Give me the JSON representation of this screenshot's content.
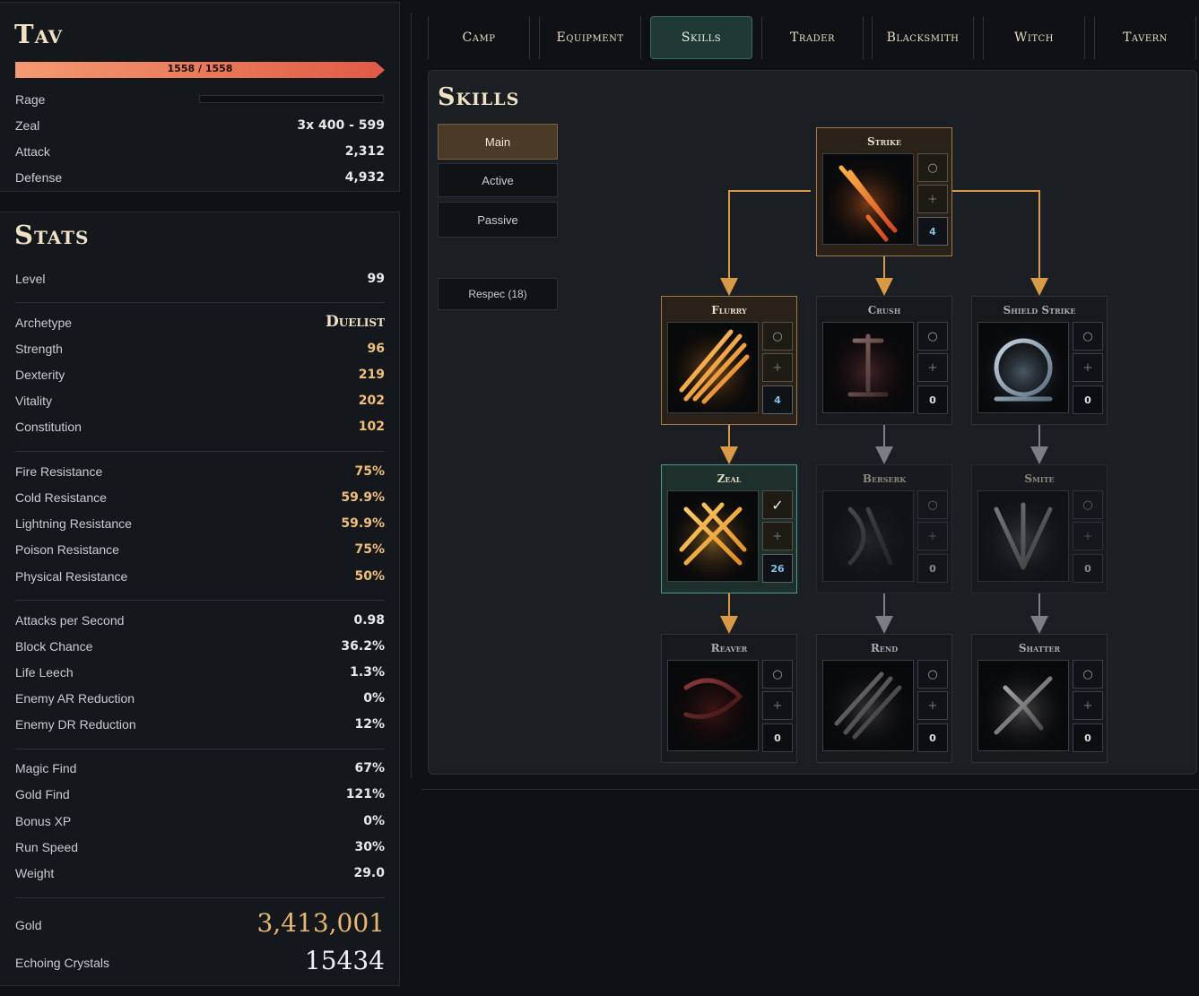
{
  "character": {
    "name": "Tav",
    "hp": "1558 / 1558",
    "hp_fraction": 1.0,
    "rage_fraction": 0.0,
    "rows": [
      {
        "label": "Rage",
        "value": ""
      },
      {
        "label": "Zeal",
        "value": "3x 400 - 599"
      },
      {
        "label": "Attack",
        "value": "2,312"
      },
      {
        "label": "Defense",
        "value": "4,932"
      }
    ]
  },
  "stats": {
    "title": "Stats",
    "level": {
      "label": "Level",
      "value": "99"
    },
    "archetype": {
      "label": "Archetype",
      "value": "Duelist"
    },
    "attributes": [
      {
        "label": "Strength",
        "value": "96"
      },
      {
        "label": "Dexterity",
        "value": "219"
      },
      {
        "label": "Vitality",
        "value": "202"
      },
      {
        "label": "Constitution",
        "value": "102"
      }
    ],
    "resistances": [
      {
        "label": "Fire Resistance",
        "value": "75%"
      },
      {
        "label": "Cold Resistance",
        "value": "59.9%"
      },
      {
        "label": "Lightning Resistance",
        "value": "59.9%"
      },
      {
        "label": "Poison Resistance",
        "value": "75%"
      },
      {
        "label": "Physical Resistance",
        "value": "50%"
      }
    ],
    "combat": [
      {
        "label": "Attacks per Second",
        "value": "0.98"
      },
      {
        "label": "Block Chance",
        "value": "36.2%"
      },
      {
        "label": "Life Leech",
        "value": "1.3%"
      },
      {
        "label": "Enemy AR Reduction",
        "value": "0%"
      },
      {
        "label": "Enemy DR Reduction",
        "value": "12%"
      }
    ],
    "misc": [
      {
        "label": "Magic Find",
        "value": "67%"
      },
      {
        "label": "Gold Find",
        "value": "121%"
      },
      {
        "label": "Bonus XP",
        "value": "0%"
      },
      {
        "label": "Run Speed",
        "value": "30%"
      },
      {
        "label": "Weight",
        "value": "29.0"
      }
    ],
    "gold": {
      "label": "Gold",
      "value": "3,413,001"
    },
    "crystals": {
      "label": "Echoing Crystals",
      "value": "15434"
    }
  },
  "nav": {
    "tabs": [
      "Camp",
      "Equipment",
      "Skills",
      "Trader",
      "Blacksmith",
      "Witch",
      "Tavern"
    ],
    "active": "Skills"
  },
  "skills": {
    "title": "Skills",
    "categories": [
      "Main",
      "Active",
      "Passive"
    ],
    "active_category": "Main",
    "respec_label": "Respec (18)",
    "button_symbols": {
      "select": "○",
      "add": "+",
      "selected": "✓"
    },
    "nodes": [
      {
        "id": "strike",
        "name": "Strike",
        "level": "4",
        "state": "owned",
        "icon": "strike-icon"
      },
      {
        "id": "flurry",
        "name": "Flurry",
        "level": "4",
        "state": "owned",
        "icon": "flurry-icon"
      },
      {
        "id": "crush",
        "name": "Crush",
        "level": "0",
        "state": "locked",
        "icon": "crush-icon"
      },
      {
        "id": "shield-strike",
        "name": "Shield Strike",
        "level": "0",
        "state": "locked",
        "icon": "shield-strike-icon"
      },
      {
        "id": "zeal",
        "name": "Zeal",
        "level": "26",
        "state": "selected",
        "icon": "zeal-icon"
      },
      {
        "id": "berserk",
        "name": "Berserk",
        "level": "0",
        "state": "dim",
        "icon": "berserk-icon"
      },
      {
        "id": "smite",
        "name": "Smite",
        "level": "0",
        "state": "dim",
        "icon": "smite-icon"
      },
      {
        "id": "reaver",
        "name": "Reaver",
        "level": "0",
        "state": "locked",
        "icon": "reaver-icon"
      },
      {
        "id": "rend",
        "name": "Rend",
        "level": "0",
        "state": "locked",
        "icon": "rend-icon"
      },
      {
        "id": "shatter",
        "name": "Shatter",
        "level": "0",
        "state": "locked",
        "icon": "shatter-icon"
      }
    ]
  },
  "colors": {
    "accent_orange": "#f0c079",
    "gold": "#e8b870",
    "active_tab": "#1f3a34",
    "owned_border": "#a27a45",
    "selected_border": "#4f9a86",
    "connector_active": "#d99a45",
    "connector_inactive": "#7a7e85"
  }
}
